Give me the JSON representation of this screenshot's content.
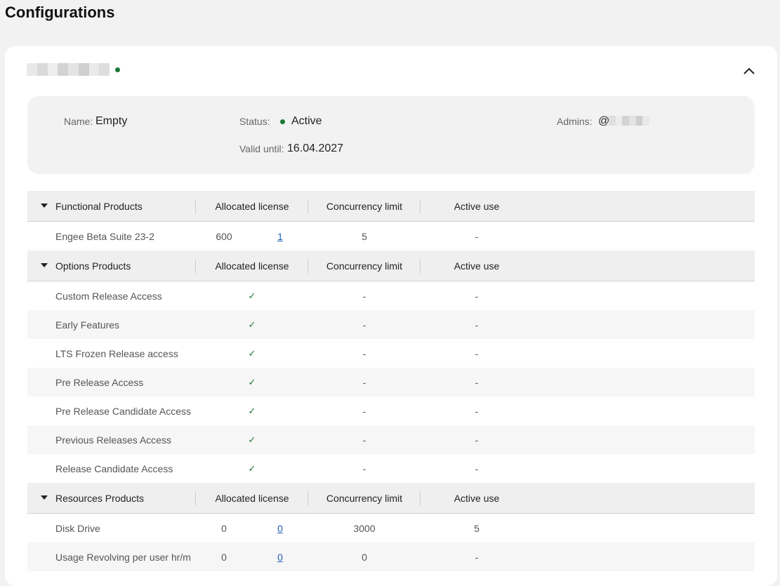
{
  "page": {
    "title": "Configurations"
  },
  "config": {
    "status_color": "#1a7a35",
    "info": {
      "name_label": "Name:",
      "name_value": "Empty",
      "status_label": "Status:",
      "status_value": "Active",
      "valid_label": "Valid until:",
      "valid_value": "16.04.2027",
      "admins_label": "Admins:",
      "admins_prefix": "@"
    }
  },
  "columns": {
    "allocated": "Allocated license",
    "concurrency": "Concurrency limit",
    "active": "Active use"
  },
  "sections": {
    "functional": {
      "title": "Functional Products",
      "rows": [
        {
          "name": "Engee Beta Suite 23-2",
          "allocated": "600",
          "allocated_link": "1",
          "concurrency": "5",
          "active": "-"
        }
      ]
    },
    "options": {
      "title": "Options Products",
      "rows": [
        {
          "name": "Custom Release Access",
          "allocated": "✓",
          "concurrency": "-",
          "active": "-"
        },
        {
          "name": "Early Features",
          "allocated": "✓",
          "concurrency": "-",
          "active": "-"
        },
        {
          "name": "LTS Frozen Release access",
          "allocated": "✓",
          "concurrency": "-",
          "active": "-"
        },
        {
          "name": "Pre Release Access",
          "allocated": "✓",
          "concurrency": "-",
          "active": "-"
        },
        {
          "name": "Pre Release Candidate Access",
          "allocated": "✓",
          "concurrency": "-",
          "active": "-"
        },
        {
          "name": "Previous Releases Access",
          "allocated": "✓",
          "concurrency": "-",
          "active": "-"
        },
        {
          "name": "Release Candidate Access",
          "allocated": "✓",
          "concurrency": "-",
          "active": "-"
        }
      ]
    },
    "resources": {
      "title": "Resources Products",
      "rows": [
        {
          "name": "Disk Drive",
          "allocated": "0",
          "allocated_link": "0",
          "concurrency": "3000",
          "active": "5"
        },
        {
          "name": "Usage Revolving per user hr/m",
          "allocated": "0",
          "allocated_link": "0",
          "concurrency": "0",
          "active": "-"
        }
      ]
    }
  }
}
